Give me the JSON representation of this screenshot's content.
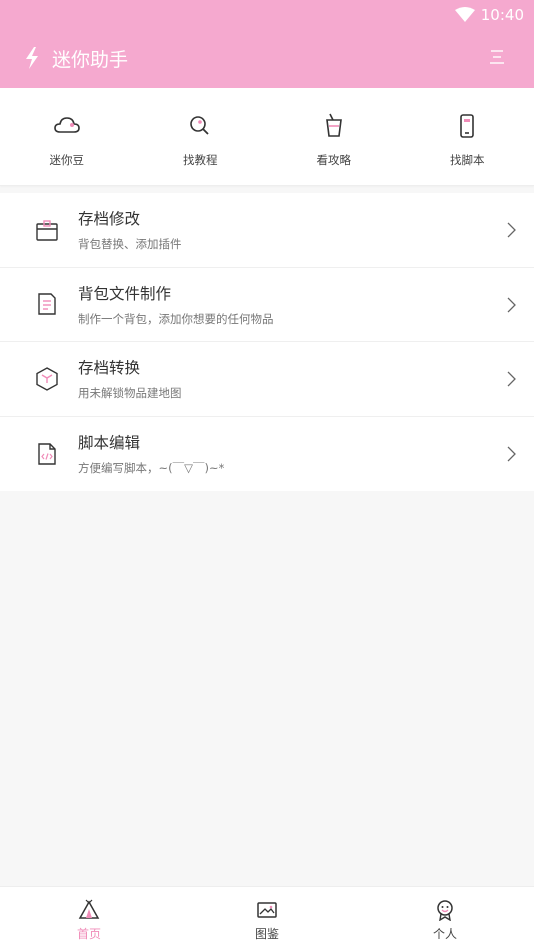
{
  "status_bar": {
    "time": "10:40"
  },
  "header": {
    "title": "迷你助手"
  },
  "shortcuts": [
    {
      "label": "迷你豆",
      "icon": "cloud-icon"
    },
    {
      "label": "找教程",
      "icon": "search-icon"
    },
    {
      "label": "看攻略",
      "icon": "drink-icon"
    },
    {
      "label": "找脚本",
      "icon": "phone-icon"
    }
  ],
  "features": [
    {
      "title": "存档修改",
      "subtitle": "背包替换、添加插件",
      "icon": "box-icon"
    },
    {
      "title": "背包文件制作",
      "subtitle": "制作一个背包，添加你想要的任何物品",
      "icon": "document-icon"
    },
    {
      "title": "存档转换",
      "subtitle": "用未解锁物品建地图",
      "icon": "cube-icon"
    },
    {
      "title": "脚本编辑",
      "subtitle": "方便编写脚本，~(￣▽￣)~*",
      "icon": "code-file-icon"
    }
  ],
  "tabs": [
    {
      "label": "首页",
      "icon": "tent-icon",
      "active": true
    },
    {
      "label": "图鉴",
      "icon": "image-icon",
      "active": false
    },
    {
      "label": "个人",
      "icon": "user-icon",
      "active": false
    }
  ],
  "colors": {
    "accent": "#f5a9cf",
    "accent_text": "#f08cb8",
    "background": "#f7f7f7"
  }
}
